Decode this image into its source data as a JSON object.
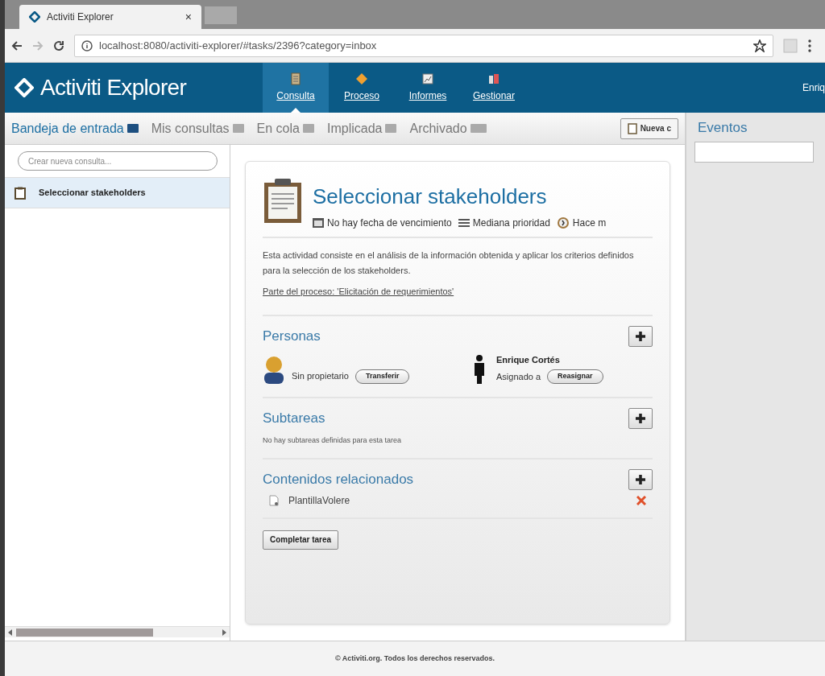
{
  "browser": {
    "tab_title": "Activiti Explorer",
    "tab_close": "×",
    "url": "localhost:8080/activiti-explorer/#tasks/2396?category=inbox"
  },
  "header": {
    "logo": "Activiti Explorer",
    "user": "Enriq",
    "nav": [
      {
        "label": "Consulta",
        "selected": true
      },
      {
        "label": "Proceso",
        "selected": false
      },
      {
        "label": "Informes",
        "selected": false
      },
      {
        "label": "Gestionar",
        "selected": false
      }
    ]
  },
  "subtabs": [
    {
      "label": "Bandeja de entrada",
      "selected": true
    },
    {
      "label": "Mis consultas",
      "selected": false
    },
    {
      "label": "En cola",
      "selected": false
    },
    {
      "label": "Implicada",
      "selected": false
    },
    {
      "label": "Archivado",
      "selected": false
    }
  ],
  "new_button": "Nueva c",
  "sidebar": {
    "search_placeholder": "Crear nueva consulta...",
    "items": [
      {
        "label": "Seleccionar stakeholders",
        "selected": true
      }
    ]
  },
  "task": {
    "title": "Seleccionar stakeholders",
    "due": "No hay fecha de vencimiento",
    "priority": "Mediana prioridad",
    "created": "Hace m",
    "description": "Esta actividad consiste en el  análisis de la información  obtenida y aplicar los criterios definidos para la selección  de los stakeholders.",
    "process_link": "Parte del proceso: 'Elicitación  de requerimientos'",
    "people": {
      "title": "Personas",
      "owner": {
        "text": "Sin propietario",
        "button": "Transferir"
      },
      "assignee": {
        "name": "Enrique Cortés",
        "text": "Asignado a",
        "button": "Reasignar"
      }
    },
    "subtasks": {
      "title": "Subtareas",
      "empty": "No hay subtareas definidas para esta tarea"
    },
    "related": {
      "title": "Contenidos relacionados",
      "items": [
        {
          "name": "PlantillaVolere"
        }
      ]
    },
    "complete_button": "Completar tarea"
  },
  "events": {
    "title": "Eventos"
  },
  "footer": "© Activiti.org. Todos los derechos reservados."
}
